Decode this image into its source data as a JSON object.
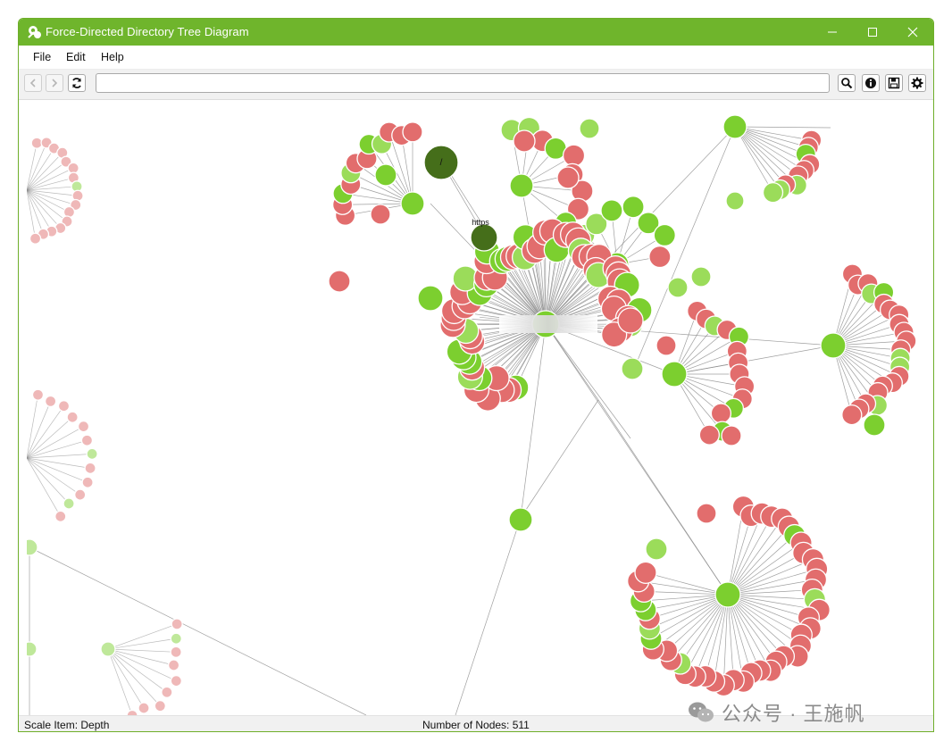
{
  "window": {
    "title": "Force-Directed Directory Tree Diagram",
    "titlebar_color": "#6fb52c"
  },
  "menu": {
    "items": [
      {
        "label": "File"
      },
      {
        "label": "Edit"
      },
      {
        "label": "Help"
      }
    ]
  },
  "toolbar": {
    "address_value": "",
    "buttons": [
      "back-icon",
      "forward-icon",
      "refresh-icon",
      "search-icon",
      "info-icon",
      "save-icon",
      "settings-icon"
    ]
  },
  "graph": {
    "root_label": "/",
    "https_label": "https",
    "colors": {
      "file_node": "#e26d6d",
      "dir_node": "#7ccf2f",
      "dir_node_light": "#9bdc5a",
      "root_node": "#456e1a",
      "faded_file": "#efb8b8",
      "faded_dir": "#bfe89a",
      "edge": "#8e8e8e"
    }
  },
  "status": {
    "scale_item": "Scale Item: Depth",
    "node_count": "Number of Nodes: 511"
  },
  "watermark": {
    "text": "公众号 · 王施帆"
  }
}
